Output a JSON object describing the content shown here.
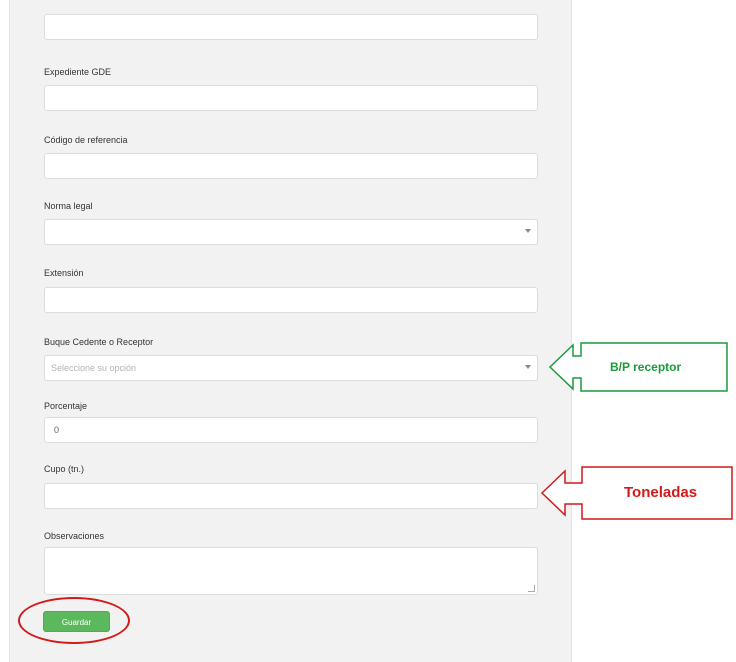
{
  "form": {
    "fields": [
      {
        "label": "",
        "value": ""
      },
      {
        "label": "Expediente GDE",
        "value": ""
      },
      {
        "label": "Código de referencia",
        "value": ""
      },
      {
        "label": "Norma legal",
        "value": ""
      },
      {
        "label": "Extensión",
        "value": ""
      },
      {
        "label": "Buque Cedente o Receptor",
        "placeholder": "Seleccione su opción"
      },
      {
        "label": "Porcentaje",
        "value": "0"
      },
      {
        "label": "Cupo (tn.)",
        "value": ""
      },
      {
        "label": "Observaciones",
        "value": ""
      }
    ],
    "save_label": "Guardar"
  },
  "annotations": {
    "receptor_callout": {
      "text": "B/P   receptor",
      "color": "#1a9b3c"
    },
    "toneladas_callout": {
      "text": "Toneladas",
      "color": "#d21a1a"
    },
    "save_highlight_color": "#d21a1a"
  },
  "icons": [
    "dropdown-caret-icon",
    "resize-grip-icon",
    "left-arrow-callout-icon"
  ]
}
